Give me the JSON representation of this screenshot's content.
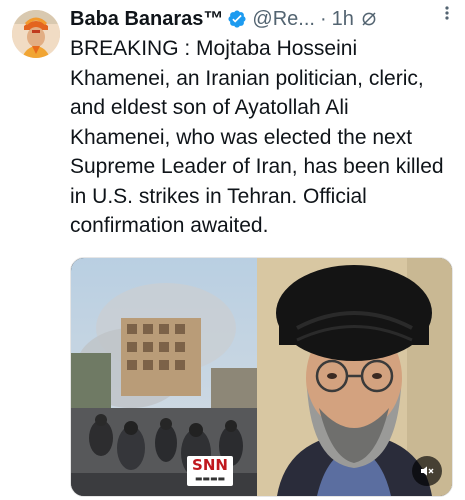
{
  "author": {
    "display_name": "Baba Banaras™",
    "handle": "@Re...",
    "separator": "·",
    "time": "1h",
    "verified": true,
    "verified_color": "#1d9bf0"
  },
  "tweet": {
    "text": "BREAKING : Mojtaba Hosseini Khamenei, an Iranian politician, cleric, and eldest son of Ayatollah Ali Khamenei, who was elected the next Supreme Leader of Iran, has been killed in U.S. strikes in Tehran. Official confirmation awaited."
  },
  "media": {
    "left_image": "street-smoke-news-footage",
    "right_image": "cleric-portrait",
    "watermark": "SNN",
    "mute_icon": "muted-speaker-icon"
  },
  "icons": {
    "verified": "verified-badge-icon",
    "grok": "grok-icon",
    "more": "more-options-icon"
  },
  "colors": {
    "text": "#0f1419",
    "secondary": "#536471",
    "accent": "#1d9bf0"
  }
}
